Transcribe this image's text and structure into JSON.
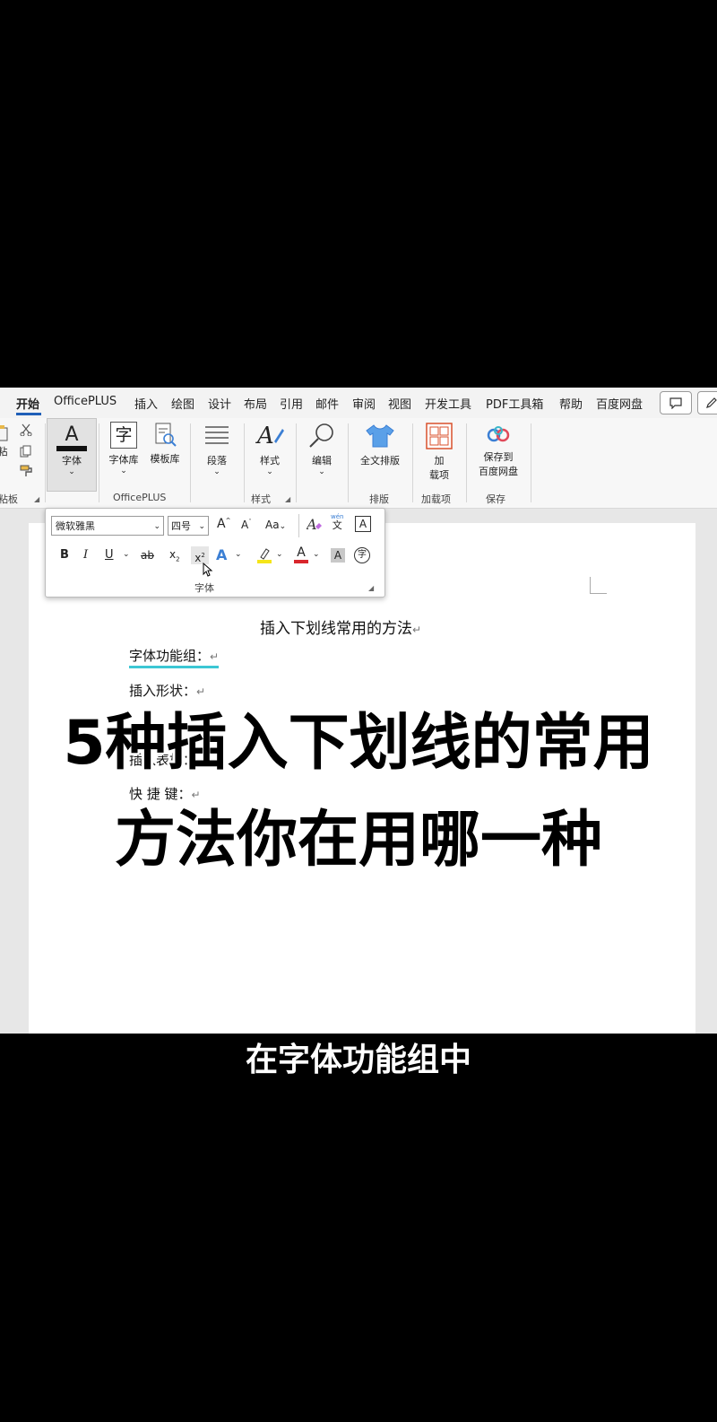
{
  "menu": {
    "items": [
      "开始",
      "OfficePLUS",
      "插入",
      "绘图",
      "设计",
      "布局",
      "引用",
      "邮件",
      "审阅",
      "视图",
      "开发工具",
      "PDF工具箱",
      "帮助",
      "百度网盘"
    ]
  },
  "ribbon": {
    "clipboard": {
      "paste_label": "粘",
      "group_label": "粘板"
    },
    "font_btn": "字体",
    "font_lib": "字体库",
    "template_lib": "模板库",
    "paragraph": "段落",
    "styles": "样式",
    "edit": "编辑",
    "typeset": "全文排版",
    "addin": [
      "加",
      "载项"
    ],
    "save_to": [
      "保存到",
      "百度网盘"
    ],
    "groups": {
      "officeplus": "OfficePLUS",
      "styles": "样式",
      "typeset": "排版",
      "addins": "加载项",
      "save": "保存"
    },
    "font_glyph_a": "A",
    "font_glyph_zi": "字"
  },
  "font_popup": {
    "font_name": "微软雅黑",
    "font_size": "四号",
    "grow": "A",
    "shrink": "A",
    "case": "Aa",
    "phonetic_top": "wén",
    "phonetic_bottom": "文",
    "border_char": "A",
    "bold": "B",
    "italic": "I",
    "underline": "U",
    "strike": "ab",
    "subscript": "x",
    "superscript": "x",
    "effects": "A",
    "font_color": "A",
    "shading": "A",
    "enclose": "字",
    "group_label": "字体"
  },
  "document": {
    "title": "插入下划线常用的方法",
    "lines": [
      "字体功能组：",
      "插入形状：",
      "插入表格：",
      "快 捷 键："
    ]
  },
  "overlay": {
    "line1": "5种插入下划线的常用",
    "line2": "方法你在用哪一种"
  },
  "subtitle": "在字体功能组中",
  "colors": {
    "accent": "#1f5fb8",
    "highlight_underline": "#3cc7d4",
    "font_color_bar": "#d9262c",
    "highlight_bar": "#f5e51a"
  }
}
